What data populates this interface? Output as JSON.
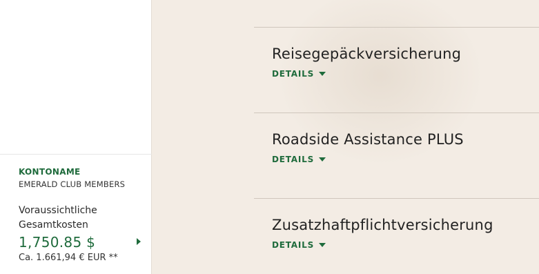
{
  "sidebar": {
    "account_label": "KONTONAME",
    "account_name": "EMERALD CLUB MEMBERS",
    "total_label": "Voraussichtliche Gesamtkosten",
    "total_amount": "1,750.85 $",
    "total_eur": "Ca. 1.661,94 € EUR **"
  },
  "items": [
    {
      "title": "Reisegepäckversicherung",
      "details_label": "DETAILS"
    },
    {
      "title": "Roadside Assistance PLUS",
      "details_label": "DETAILS"
    },
    {
      "title": "Zusatzhaftpflichtversicherung",
      "details_label": "DETAILS"
    }
  ],
  "colors": {
    "accent": "#1f6b3c",
    "background": "#f3ece4"
  },
  "icons": {
    "details_caret": "caret-down-icon",
    "total_expand": "caret-right-icon"
  }
}
